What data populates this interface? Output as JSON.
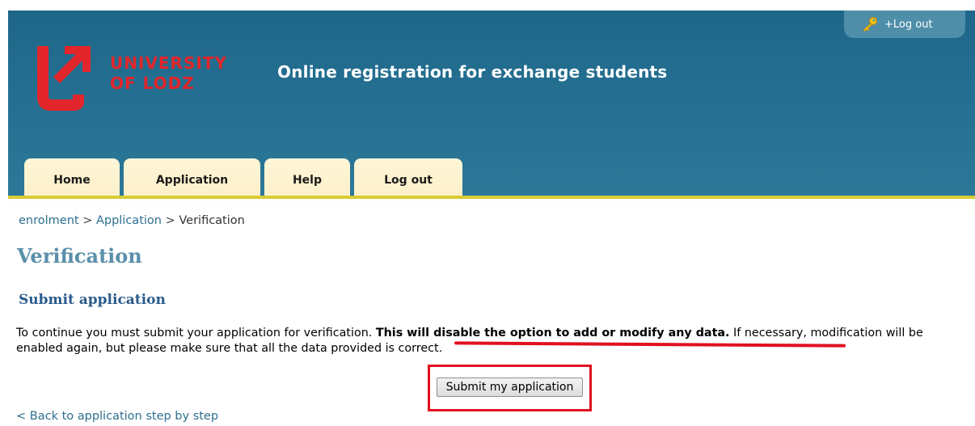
{
  "header": {
    "logo_line1": "UNIVERSITY",
    "logo_line2": "OF LODZ",
    "title": "Online registration for exchange students",
    "logout_pill": "+Log out"
  },
  "tabs": [
    {
      "label": "Home"
    },
    {
      "label": "Application"
    },
    {
      "label": "Help"
    },
    {
      "label": "Log out"
    }
  ],
  "breadcrumb": {
    "items": [
      "enrolment",
      "Application",
      "Verification"
    ],
    "separator": ">"
  },
  "page_title": "Verification",
  "section_title": "Submit application",
  "message": {
    "before": "To continue you must submit your application for verification. ",
    "warning": "This will disable the option to add or modify any data.",
    "after": " If necessary, modification will be enabled again, but please make sure that all the data provided is correct."
  },
  "submit_label": "Submit my application",
  "back_link": "< Back to application step by step",
  "colors": {
    "header_blue": "#246f91",
    "accent_red": "#e3262b",
    "link_blue": "#2d6f8f",
    "tab_bg": "#fdf0c9",
    "header_line_yellow": "#d8cc34"
  },
  "icons": {
    "logout": "key-icon",
    "logo": "university-logo-icon"
  }
}
